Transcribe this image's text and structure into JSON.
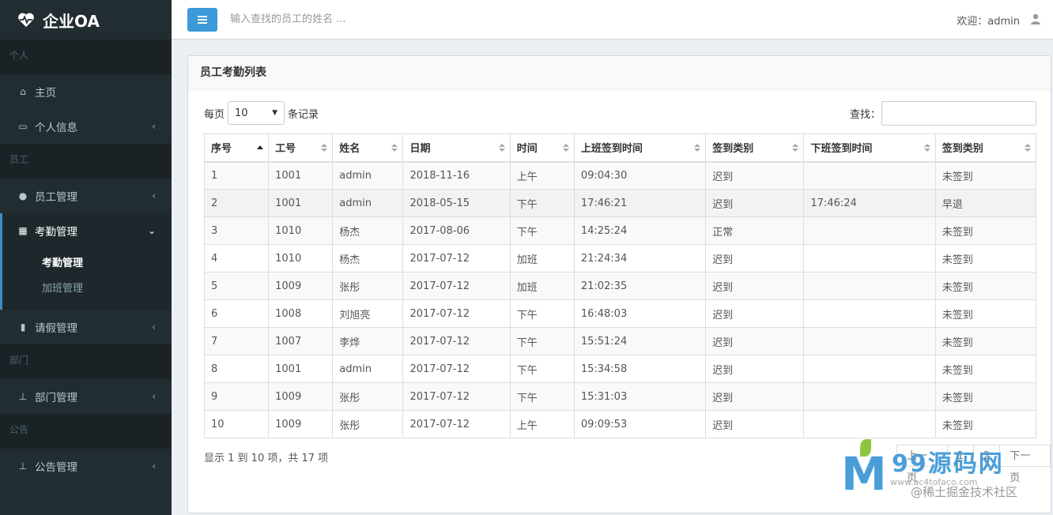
{
  "app": {
    "title": "企业OA"
  },
  "sidebar": {
    "sections": [
      {
        "header": "个人",
        "items": [
          {
            "label": "主页",
            "icon": "home-icon"
          },
          {
            "label": "个人信息",
            "icon": "id-card-icon"
          }
        ]
      },
      {
        "header": "员工",
        "items": [
          {
            "label": "员工管理",
            "icon": "user-icon"
          },
          {
            "label": "考勤管理",
            "icon": "calendar-icon",
            "sub": [
              "考勤管理",
              "加班管理"
            ]
          },
          {
            "label": "请假管理",
            "icon": "bookmark-icon"
          }
        ]
      },
      {
        "header": "部门",
        "items": [
          {
            "label": "部门管理",
            "icon": "sitemap-icon"
          }
        ]
      },
      {
        "header": "公告",
        "items": [
          {
            "label": "公告管理",
            "icon": "sitemap-icon"
          }
        ]
      }
    ]
  },
  "header": {
    "search_placeholder": "输入查找的员工的姓名 ...",
    "welcome": "欢迎：admin"
  },
  "box": {
    "title": "员工考勤列表",
    "length_prefix": "每页",
    "length_value": "10",
    "length_suffix": "条记录",
    "search_label": "查找：",
    "columns": [
      "序号",
      "工号",
      "姓名",
      "日期",
      "时间",
      "上班签到时间",
      "签到类别",
      "下班签到时间",
      "签到类别"
    ],
    "rows": [
      [
        "1",
        "1001",
        "admin",
        "2018-11-16",
        "上午",
        "09:04:30",
        "迟到",
        "",
        "未签到"
      ],
      [
        "2",
        "1001",
        "admin",
        "2018-05-15",
        "下午",
        "17:46:21",
        "迟到",
        "17:46:24",
        "早退"
      ],
      [
        "3",
        "1010",
        "杨杰",
        "2017-08-06",
        "下午",
        "14:25:24",
        "正常",
        "",
        "未签到"
      ],
      [
        "4",
        "1010",
        "杨杰",
        "2017-07-12",
        "加班",
        "21:24:34",
        "迟到",
        "",
        "未签到"
      ],
      [
        "5",
        "1009",
        "张彤",
        "2017-07-12",
        "加班",
        "21:02:35",
        "迟到",
        "",
        "未签到"
      ],
      [
        "6",
        "1008",
        "刘旭亮",
        "2017-07-12",
        "下午",
        "16:48:03",
        "迟到",
        "",
        "未签到"
      ],
      [
        "7",
        "1007",
        "李烨",
        "2017-07-12",
        "下午",
        "15:51:24",
        "迟到",
        "",
        "未签到"
      ],
      [
        "8",
        "1001",
        "admin",
        "2017-07-12",
        "下午",
        "15:34:58",
        "迟到",
        "",
        "未签到"
      ],
      [
        "9",
        "1009",
        "张彤",
        "2017-07-12",
        "下午",
        "15:31:03",
        "迟到",
        "",
        "未签到"
      ],
      [
        "10",
        "1009",
        "张彤",
        "2017-07-12",
        "上午",
        "09:09:53",
        "迟到",
        "",
        "未签到"
      ]
    ],
    "info": "显示 1 到 10 项，共 17 项",
    "pager": [
      "上一页",
      "1",
      "2",
      "下一页"
    ]
  },
  "watermark": {
    "brand": "99源码网",
    "url": "www.ac4tofaco.com",
    "community": "@稀土掘金技术社区"
  },
  "colors": {
    "sidebar_bg": "#222d32",
    "accent": "#3c8dbc",
    "toggle": "#3c9ad8"
  }
}
